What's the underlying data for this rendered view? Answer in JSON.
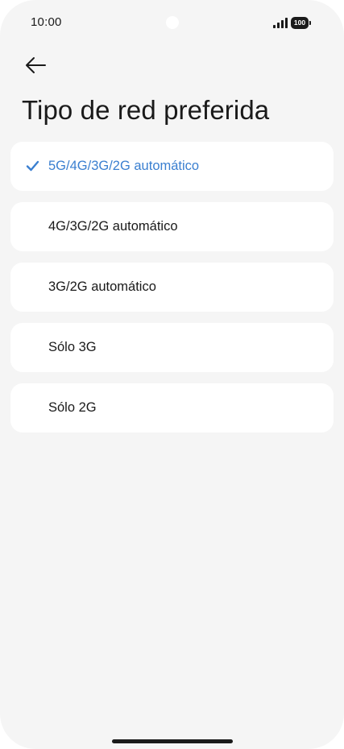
{
  "status_bar": {
    "time": "10:00",
    "battery_level": "100"
  },
  "header": {
    "title": "Tipo de red preferida",
    "back_icon": "arrow-left-icon"
  },
  "options": [
    {
      "label": "5G/4G/3G/2G automático",
      "selected": true
    },
    {
      "label": "4G/3G/2G automático",
      "selected": false
    },
    {
      "label": "3G/2G automático",
      "selected": false
    },
    {
      "label": "Sólo 3G",
      "selected": false
    },
    {
      "label": "Sólo 2G",
      "selected": false
    }
  ],
  "colors": {
    "accent": "#3a7fd0",
    "background": "#f5f5f5",
    "card": "#ffffff",
    "text": "#1a1a1a"
  },
  "icons": {
    "check": "checkmark-icon",
    "signal": "signal-icon",
    "battery": "battery-icon"
  }
}
